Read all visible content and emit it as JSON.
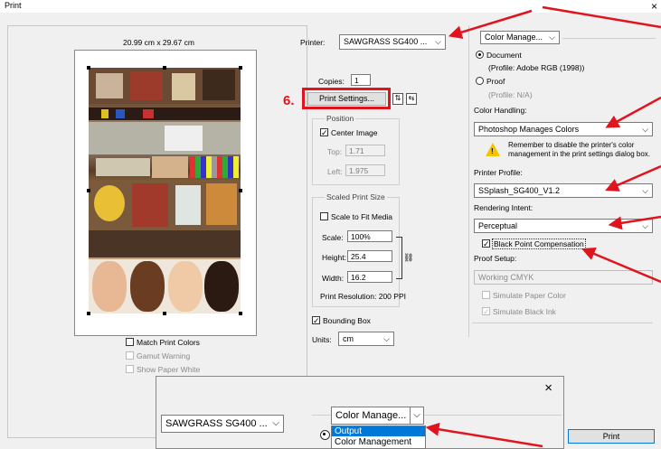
{
  "window": {
    "title": "Print",
    "close": "×"
  },
  "preview": {
    "page_size": "20.99 cm x 29.67 cm",
    "match_print_colors": "Match Print Colors",
    "gamut_warning": "Gamut Warning",
    "show_paper_white": "Show Paper White"
  },
  "printer": {
    "label": "Printer:",
    "value": "SAWGRASS SG400 ..."
  },
  "copies": {
    "label": "Copies:",
    "value": "1"
  },
  "step_marker": "6.",
  "print_settings_button": "Print Settings...",
  "position": {
    "title": "Position",
    "center_image": "Center Image",
    "top_label": "Top:",
    "top_value": "1.71",
    "left_label": "Left:",
    "left_value": "1.975"
  },
  "scaled": {
    "title": "Scaled Print Size",
    "scale_to_fit": "Scale to Fit Media",
    "scale_label": "Scale:",
    "scale_value": "100%",
    "height_label": "Height:",
    "height_value": "25.4",
    "width_label": "Width:",
    "width_value": "16.2",
    "resolution": "Print Resolution: 200 PPI"
  },
  "bounding_box": "Bounding Box",
  "units": {
    "label": "Units:",
    "value": "cm"
  },
  "color": {
    "section_select": "Color Manage...",
    "document": "Document",
    "document_profile": "(Profile: Adobe RGB (1998))",
    "proof": "Proof",
    "proof_profile": "(Profile: N/A)",
    "handling_label": "Color Handling:",
    "handling_value": "Photoshop Manages Colors",
    "warning_text": "Remember to disable the printer's color management in the print settings dialog box.",
    "printer_profile_label": "Printer Profile:",
    "printer_profile_value": "SSplash_SG400_V1.2",
    "rendering_label": "Rendering Intent:",
    "rendering_value": "Perceptual",
    "bpc": "Black Point Compensation",
    "proof_setup_label": "Proof Setup:",
    "proof_setup_value": "Working CMYK",
    "simulate_paper": "Simulate Paper Color",
    "simulate_ink": "Simulate Black Ink"
  },
  "print_button": "Print",
  "overlay": {
    "close": "×",
    "printer_value": "SAWGRASS SG400 ...",
    "section_select": "Color Manage...",
    "options": [
      "Output",
      "Color Management"
    ]
  },
  "colors": {
    "accent_red": "#e1141e",
    "highlight_blue": "#0078d7"
  }
}
